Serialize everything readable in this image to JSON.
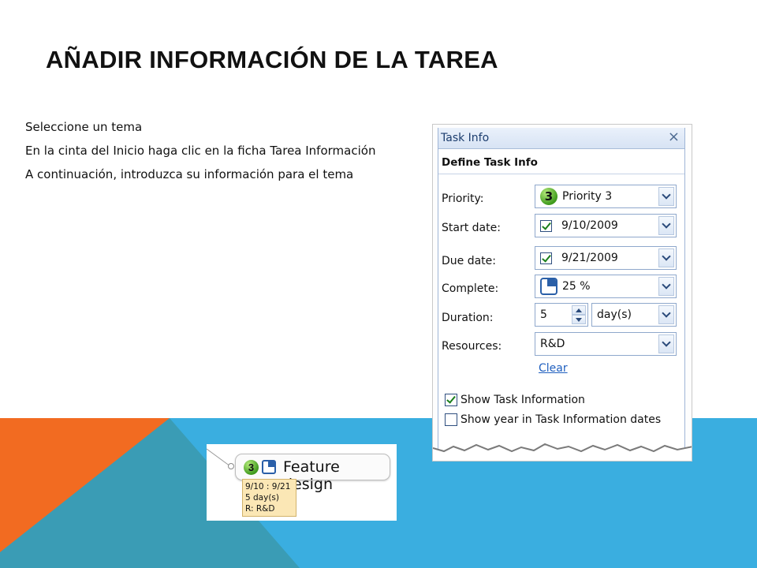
{
  "slide": {
    "title": "AÑADIR INFORMACIÓN DE LA TAREA",
    "bullets": [
      "Seleccione un tema",
      "En la cinta del Inicio haga clic en la ficha Tarea Información",
      "A continuación, introduzca su información para el tema"
    ],
    "colors": {
      "orange": "#f26b21",
      "teal": "#3a9cb5",
      "blue": "#3aaee0"
    }
  },
  "task_info": {
    "panel_title": "Task Info",
    "section_title": "Define Task Info",
    "priority": {
      "label": "Priority:",
      "badge": "3",
      "value": "Priority 3"
    },
    "start_date": {
      "label": "Start date:",
      "checked": true,
      "value": "9/10/2009"
    },
    "due_date": {
      "label": "Due date:",
      "checked": true,
      "value": "9/21/2009"
    },
    "complete": {
      "label": "Complete:",
      "value": "25 %"
    },
    "duration": {
      "label": "Duration:",
      "value": "5",
      "unit": "day(s)"
    },
    "resources": {
      "label": "Resources:",
      "value": "R&D"
    },
    "clear_link": "Clear",
    "show_task_info": {
      "label": "Show Task Information",
      "checked": true
    },
    "show_year": {
      "label": "Show year in Task Information dates",
      "checked": false
    }
  },
  "topic": {
    "badge": "3",
    "title": "Feature design",
    "dates": "9/10 : 9/21",
    "duration": "5 day(s)",
    "resources": "R: R&D"
  }
}
